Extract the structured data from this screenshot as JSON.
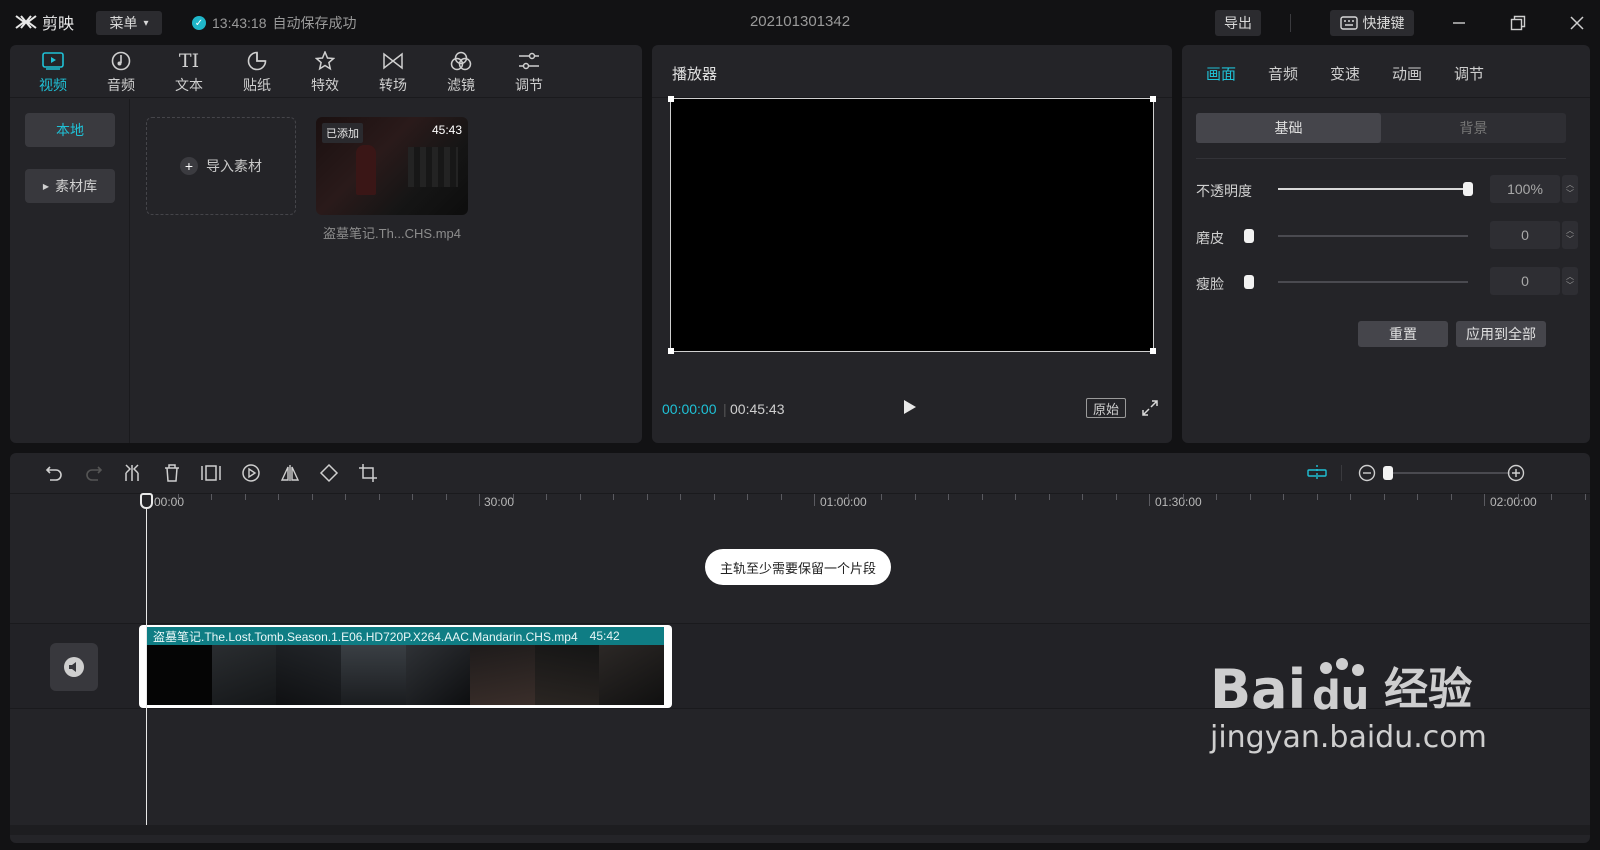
{
  "app": {
    "name": "剪映",
    "menu_label": "菜单",
    "autosave_time": "13:43:18",
    "autosave_text": "自动保存成功",
    "project_title": "202101301342",
    "export_label": "导出",
    "shortcut_label": "快捷键"
  },
  "media_tabs": [
    {
      "label": "视频",
      "icon": "video-icon"
    },
    {
      "label": "音频",
      "icon": "music-icon"
    },
    {
      "label": "文本",
      "icon": "text-icon"
    },
    {
      "label": "贴纸",
      "icon": "sticker-icon"
    },
    {
      "label": "特效",
      "icon": "effects-icon"
    },
    {
      "label": "转场",
      "icon": "transition-icon"
    },
    {
      "label": "滤镜",
      "icon": "filter-icon"
    },
    {
      "label": "调节",
      "icon": "adjust-icon"
    }
  ],
  "sidebar": {
    "local_label": "本地",
    "library_label": "素材库"
  },
  "media": {
    "import_label": "导入素材",
    "added_badge": "已添加",
    "duration": "45:43",
    "file_name": "盗墓笔记.Th...CHS.mp4"
  },
  "player": {
    "title": "播放器",
    "current_time": "00:00:00",
    "separator": "|",
    "total_time": "00:45:43",
    "original_label": "原始"
  },
  "props": {
    "tabs": [
      "画面",
      "音频",
      "变速",
      "动画",
      "调节"
    ],
    "seg_basic": "基础",
    "seg_background": "背景",
    "opacity_label": "不透明度",
    "opacity_value": "100%",
    "opacity_level": 1.0,
    "smooth_label": "磨皮",
    "smooth_value": "0",
    "slim_label": "瘦脸",
    "slim_value": "0",
    "reset_label": "重置",
    "apply_all_label": "应用到全部"
  },
  "timeline": {
    "ruler_labels": [
      "00:00",
      "30:00",
      "01:00:00",
      "01:30:00",
      "02:00:00"
    ],
    "toast": "主轨至少需要保留一个片段",
    "clip_name": "盗墓笔记.The.Lost.Tomb.Season.1.E06.HD720P.X264.AAC.Mandarin.CHS.mp4",
    "clip_duration": "45:42"
  },
  "watermark": {
    "brand": "Bai",
    "brand_paw": "du",
    "cn": "经验",
    "url": "jingyan.baidu.com"
  },
  "colors": {
    "accent": "#1fc1d6",
    "clip_header": "#0f7d84"
  }
}
